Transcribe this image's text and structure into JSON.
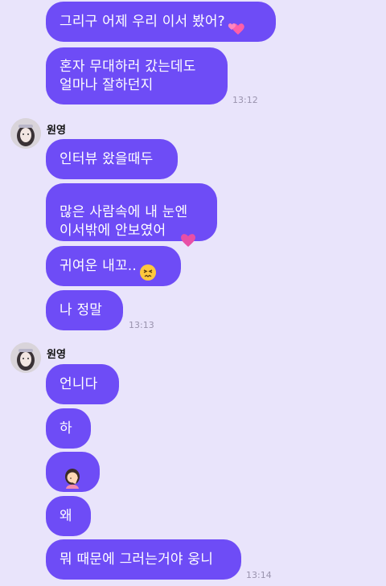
{
  "messages": {
    "m1": "그리구 어제 우리 이서 봤어?",
    "m2": "혼자 무대하러 갔는데도\n얼마나 잘하던지",
    "m3": "인터뷰 왔을때두",
    "m4": "많은 사람속에 내 눈엔\n이서밖에 안보였어",
    "m5": "귀여운 내꼬..",
    "m6": "나 정말",
    "m7": "언니다",
    "m8": "하",
    "m9": "왜",
    "m10": "뭐 때문에 그러는거야 웅니"
  },
  "times": {
    "t1": "13:12",
    "t2": "13:13",
    "t3": "13:14"
  },
  "sender": {
    "name": "원영"
  },
  "icons": {
    "two_hearts": "two-hearts-emoji",
    "purple_heart": "purple-heart-emoji",
    "confounded": "confounded-face-emoji",
    "facepalm": "woman-facepalming-emoji"
  },
  "colors": {
    "background": "#e9e4fb",
    "bubble": "#6e4cf6",
    "bubble_text": "#ffffff",
    "timestamp": "#9a93ae"
  }
}
